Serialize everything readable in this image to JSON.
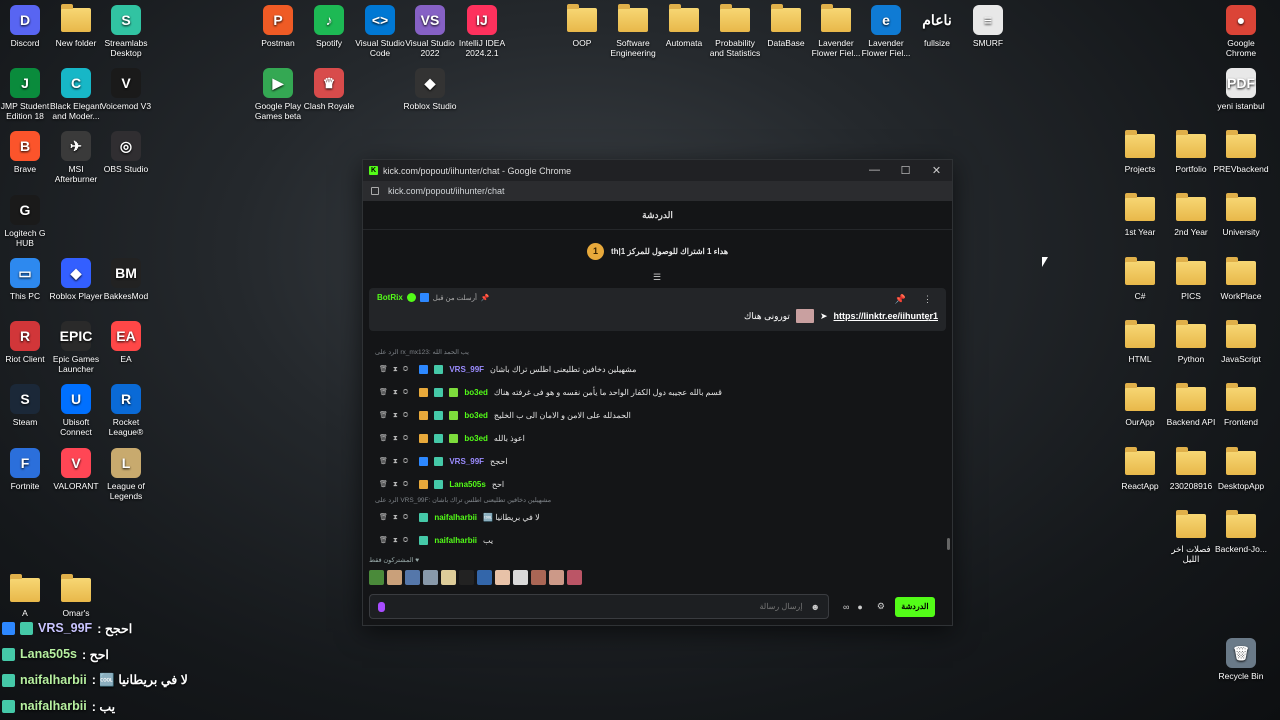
{
  "desktop": {
    "icons": [
      {
        "label": "Discord",
        "color": "#5865f2",
        "glyph": "D"
      },
      {
        "label": "New folder",
        "folder": true
      },
      {
        "label": "Streamlabs Desktop",
        "color": "#31c3a2",
        "glyph": "S"
      },
      {
        "label": "Postman",
        "color": "#ef5b25",
        "glyph": "P"
      },
      {
        "label": "Spotify",
        "color": "#1db954",
        "glyph": "♪"
      },
      {
        "label": "Visual Studio Code",
        "color": "#0078d4",
        "glyph": "<>"
      },
      {
        "label": "Visual Studio 2022",
        "color": "#8661c5",
        "glyph": "VS"
      },
      {
        "label": "IntelliJ IDEA 2024.2.1",
        "color": "#fe315d",
        "glyph": "IJ"
      },
      {
        "label": "OOP",
        "folder": true
      },
      {
        "label": "Software Engineering",
        "folder": true
      },
      {
        "label": "Automata",
        "folder": true
      },
      {
        "label": "Probability and Statistics",
        "folder": true
      },
      {
        "label": "DataBase",
        "folder": true
      },
      {
        "label": "Lavender Flower Fiel...",
        "folder": true
      },
      {
        "label": "Lavender Flower Fiel...",
        "color": "#0f7bd4",
        "glyph": "e"
      },
      {
        "label": "fullsize",
        "color": "transparent",
        "glyph": "ناعام"
      },
      {
        "label": "SMURF",
        "color": "#e8e8e8",
        "glyph": "≡"
      },
      {
        "label": "Google Chrome",
        "color": "#db4437",
        "glyph": "●"
      },
      {
        "label": "JMP Student Edition 18",
        "color": "#0a8b3c",
        "glyph": "J"
      },
      {
        "label": "Black Elegant and Moder...",
        "color": "#17b7c7",
        "glyph": "C"
      },
      {
        "label": "Voicemod V3",
        "color": "#1a1a1a",
        "glyph": "V"
      },
      {
        "label": "Google Play Games beta",
        "color": "#34a853",
        "glyph": "▶"
      },
      {
        "label": "Clash Royale",
        "color": "#d84b4b",
        "glyph": "♛"
      },
      {
        "label": "Roblox Studio",
        "color": "#333333",
        "glyph": "◆"
      },
      {
        "label": "yeni istanbul",
        "color": "#e8e8e8",
        "glyph": "PDF"
      },
      {
        "label": "Brave",
        "color": "#fb542b",
        "glyph": "B"
      },
      {
        "label": "MSI Afterburner",
        "color": "#3a3a3a",
        "glyph": "✈"
      },
      {
        "label": "OBS Studio",
        "color": "#302e31",
        "glyph": "◎"
      },
      {
        "label": "Logitech G HUB",
        "color": "#1a1a1a",
        "glyph": "G"
      },
      {
        "label": "This PC",
        "color": "#2d89ef",
        "glyph": "▭"
      },
      {
        "label": "Roblox Player",
        "color": "#335fff",
        "glyph": "◆"
      },
      {
        "label": "BakkesMod",
        "color": "#222222",
        "glyph": "BM"
      },
      {
        "label": "Riot Client",
        "color": "#d13639",
        "glyph": "R"
      },
      {
        "label": "Epic Games Launcher",
        "color": "#2a2a2a",
        "glyph": "EPIC"
      },
      {
        "label": "EA",
        "color": "#ff4747",
        "glyph": "EA"
      },
      {
        "label": "Steam",
        "color": "#1b2838",
        "glyph": "S"
      },
      {
        "label": "Ubisoft Connect",
        "color": "#0070ff",
        "glyph": "U"
      },
      {
        "label": "Rocket League®",
        "color": "#0a6ad6",
        "glyph": "R"
      },
      {
        "label": "Fortnite",
        "color": "#2b6fdb",
        "glyph": "F"
      },
      {
        "label": "VALORANT",
        "color": "#ff4655",
        "glyph": "V"
      },
      {
        "label": "League of Legends",
        "color": "#c8aa6e",
        "glyph": "L"
      },
      {
        "label": "A",
        "folder": true
      },
      {
        "label": "Omar's",
        "folder": true
      },
      {
        "label": "Projects",
        "folder": true
      },
      {
        "label": "Portfolio",
        "folder": true
      },
      {
        "label": "PREVbackend",
        "folder": true
      },
      {
        "label": "1st Year",
        "folder": true
      },
      {
        "label": "2nd Year",
        "folder": true
      },
      {
        "label": "University",
        "folder": true
      },
      {
        "label": "C#",
        "folder": true
      },
      {
        "label": "PICS",
        "folder": true
      },
      {
        "label": "WorkPlace",
        "folder": true
      },
      {
        "label": "HTML",
        "folder": true
      },
      {
        "label": "Python",
        "folder": true
      },
      {
        "label": "JavaScript",
        "folder": true
      },
      {
        "label": "OurApp",
        "folder": true
      },
      {
        "label": "Backend API",
        "folder": true
      },
      {
        "label": "Frontend",
        "folder": true
      },
      {
        "label": "ReactApp",
        "folder": true
      },
      {
        "label": "230208916",
        "folder": true
      },
      {
        "label": "DesktopApp",
        "folder": true
      },
      {
        "label": "فصلات اخر الليل",
        "folder": true
      },
      {
        "label": "Backend-Jo...",
        "folder": true
      },
      {
        "label": "Recycle Bin",
        "color": "#6a7a88",
        "glyph": "🗑"
      }
    ]
  },
  "window": {
    "title": "kick.com/popout/iihunter/chat - Google Chrome",
    "url": "kick.com/popout/iihunter/chat",
    "controls": [
      "—",
      "☐",
      "✕"
    ]
  },
  "chat": {
    "header": "الدردشة",
    "goal_number": "1",
    "goal_text": "th|هداء 1 اشتراك للوصول للمركز 1",
    "pinned": {
      "pinned_by": "أرسلت من قبل",
      "user": "BotRix",
      "link": "https://linktr.ee/iihunter1",
      "extra": "تورونی هناك"
    },
    "messages": [
      {
        "reply": "الرد على rx_mx123: يب الحمد الله",
        "user": "VRS_99F",
        "user_color": "#9b8cff",
        "text": "مشهیلین دخافین تطلیعنی اطلس تراك باشان",
        "badges": [
          "#2d88ff",
          "#45c9a8"
        ]
      },
      {
        "reply": "",
        "user": "bo3ed",
        "user_color": "#53fc18",
        "text": "قسم بالله عجیبه دول الکفار الواحد ما یأمن نفسه و هو فی غرفته هناك",
        "badges": [
          "#e8a93b",
          "#45c9a8",
          "#7ddc3c"
        ]
      },
      {
        "reply": "",
        "user": "bo3ed",
        "user_color": "#53fc18",
        "text": "الحمدلله على الامن و الامان الی ب الخلیج",
        "badges": [
          "#e8a93b",
          "#45c9a8",
          "#7ddc3c"
        ]
      },
      {
        "reply": "",
        "user": "bo3ed",
        "user_color": "#53fc18",
        "text": "اعوذ بالله",
        "badges": [
          "#e8a93b",
          "#45c9a8",
          "#7ddc3c"
        ]
      },
      {
        "reply": "",
        "user": "VRS_99F",
        "user_color": "#9b8cff",
        "text": "احجح",
        "badges": [
          "#2d88ff",
          "#45c9a8"
        ]
      },
      {
        "reply": "",
        "user": "Lana505s",
        "user_color": "#53fc18",
        "text": "احح",
        "badges": [
          "#e8a93b",
          "#45c9a8"
        ]
      },
      {
        "reply": "الرد على VRS_99F: مشهیلین دخافین تطلیعنی اطلس تراك باشان",
        "user": "naifalharbii",
        "user_color": "#53fc18",
        "text": "لا في بريطانيا 🆒",
        "badges": [
          "#45c9a8"
        ]
      },
      {
        "reply": "",
        "user": "naifalharbii",
        "user_color": "#53fc18",
        "text": "يب",
        "badges": [
          "#45c9a8"
        ]
      }
    ],
    "subscribers_label": "المشتركون فقط ♥",
    "avatar_colors": [
      "#4a8a3a",
      "#c9a07a",
      "#5577aa",
      "#8899aa",
      "#ddcc99",
      "#222222",
      "#3366aa",
      "#e8c2a8",
      "#d9d9d9",
      "#aa6655",
      "#cc9988",
      "#bb5566"
    ],
    "input_placeholder": "إرسال رسالة",
    "send_label": "الدردشة"
  },
  "overlay": [
    {
      "user": "VRS_99F",
      "text": "احجح :",
      "badges": [
        "#2d88ff",
        "#45c9a8"
      ],
      "color": "#c9c4ff"
    },
    {
      "user": "Lana505s",
      "text": "احح :",
      "badges": [
        "#45c9a8"
      ],
      "color": "#b7f0a0"
    },
    {
      "user": "naifalharbii",
      "text": "لا في بريطانيا 🆒 :",
      "badges": [
        "#45c9a8"
      ],
      "color": "#b7f0a0"
    },
    {
      "user": "naifalharbii",
      "text": "يب :",
      "badges": [
        "#45c9a8"
      ],
      "color": "#b7f0a0"
    }
  ]
}
